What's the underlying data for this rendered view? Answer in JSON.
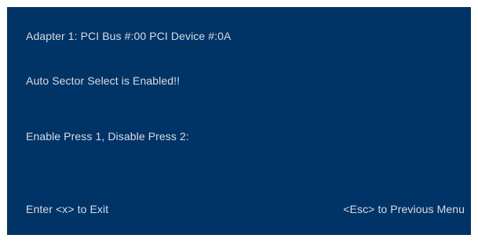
{
  "screen": {
    "background_color": "#003366",
    "text_color": "#d8dde6",
    "adapter_line": "Adapter 1: PCI Bus #:00 PCI Device #:0A",
    "status_line": "Auto Sector Select is Enabled!!",
    "prompt_line": "Enable Press 1,  Disable Press 2:",
    "footer": {
      "exit_hint": "Enter <x> to Exit",
      "back_hint": "<Esc> to Previous Menu"
    }
  }
}
